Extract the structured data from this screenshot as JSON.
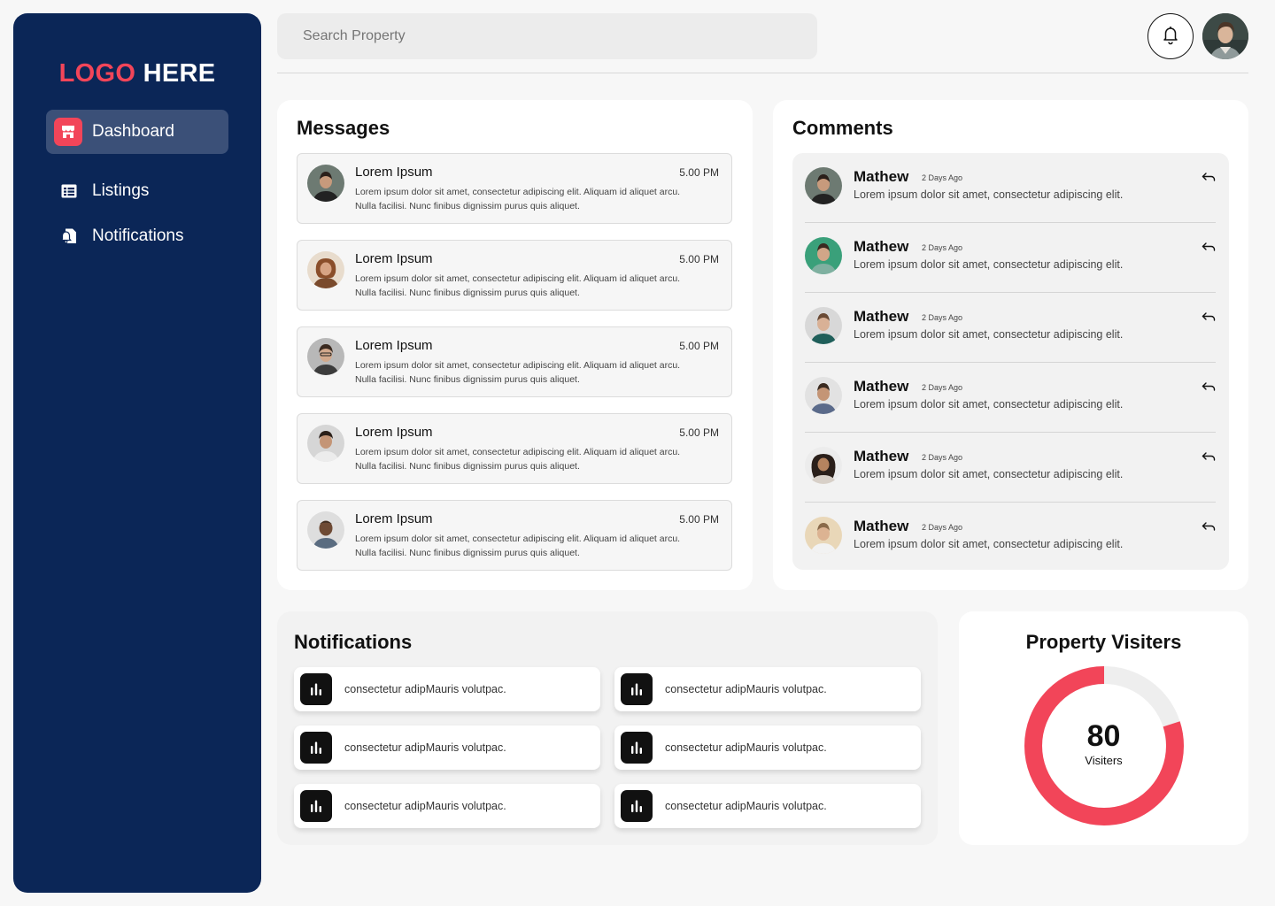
{
  "sidebar": {
    "logo_part1": "LOGO",
    "logo_part2": "HERE",
    "items": [
      {
        "label": "Dashboard",
        "icon": "store-icon",
        "active": true
      },
      {
        "label": "Listings",
        "icon": "table-icon",
        "active": false
      },
      {
        "label": "Notifications",
        "icon": "bell-doc-icon",
        "active": false
      }
    ]
  },
  "header": {
    "search_placeholder": "Search Property"
  },
  "messages": {
    "title": "Messages",
    "items": [
      {
        "name": "Lorem Ipsum",
        "time": "5.00 PM",
        "text": "Lorem ipsum dolor sit amet, consectetur adipiscing elit. Aliquam id aliquet arcu. Nulla facilisi. Nunc finibus dignissim purus quis aliquet."
      },
      {
        "name": "Lorem Ipsum",
        "time": "5.00 PM",
        "text": "Lorem ipsum dolor sit amet, consectetur adipiscing elit. Aliquam id aliquet arcu. Nulla facilisi. Nunc finibus dignissim purus quis aliquet."
      },
      {
        "name": "Lorem Ipsum",
        "time": "5.00 PM",
        "text": "Lorem ipsum dolor sit amet, consectetur adipiscing elit. Aliquam id aliquet arcu. Nulla facilisi. Nunc finibus dignissim purus quis aliquet."
      },
      {
        "name": "Lorem Ipsum",
        "time": "5.00 PM",
        "text": "Lorem ipsum dolor sit amet, consectetur adipiscing elit. Aliquam id aliquet arcu. Nulla facilisi. Nunc finibus dignissim purus quis aliquet."
      },
      {
        "name": "Lorem Ipsum",
        "time": "5.00 PM",
        "text": "Lorem ipsum dolor sit amet, consectetur adipiscing elit. Aliquam id aliquet arcu. Nulla facilisi. Nunc finibus dignissim purus quis aliquet."
      }
    ]
  },
  "comments": {
    "title": "Comments",
    "items": [
      {
        "name": "Mathew",
        "ago": "2 Days Ago",
        "text": "Lorem ipsum dolor sit amet, consectetur adipiscing elit."
      },
      {
        "name": "Mathew",
        "ago": "2 Days Ago",
        "text": "Lorem ipsum dolor sit amet, consectetur adipiscing elit."
      },
      {
        "name": "Mathew",
        "ago": "2 Days Ago",
        "text": "Lorem ipsum dolor sit amet, consectetur adipiscing elit."
      },
      {
        "name": "Mathew",
        "ago": "2 Days Ago",
        "text": "Lorem ipsum dolor sit amet, consectetur adipiscing elit."
      },
      {
        "name": "Mathew",
        "ago": "2 Days Ago",
        "text": "Lorem ipsum dolor sit amet, consectetur adipiscing elit."
      },
      {
        "name": "Mathew",
        "ago": "2 Days Ago",
        "text": "Lorem ipsum dolor sit amet, consectetur adipiscing elit."
      }
    ]
  },
  "notifications": {
    "title": "Notifications",
    "items": [
      {
        "text": "consectetur adipMauris volutpac."
      },
      {
        "text": "consectetur adipMauris volutpac."
      },
      {
        "text": "consectetur adipMauris volutpac."
      },
      {
        "text": "consectetur adipMauris volutpac."
      },
      {
        "text": "consectetur adipMauris volutpac."
      },
      {
        "text": "consectetur adipMauris volutpac."
      }
    ]
  },
  "visitors": {
    "title": "Property Visiters",
    "value": "80",
    "label": "Visiters",
    "fraction": 0.8
  },
  "colors": {
    "sidebar_bg": "#0b2657",
    "accent": "#f24559",
    "donut_track": "#eeeeee"
  }
}
